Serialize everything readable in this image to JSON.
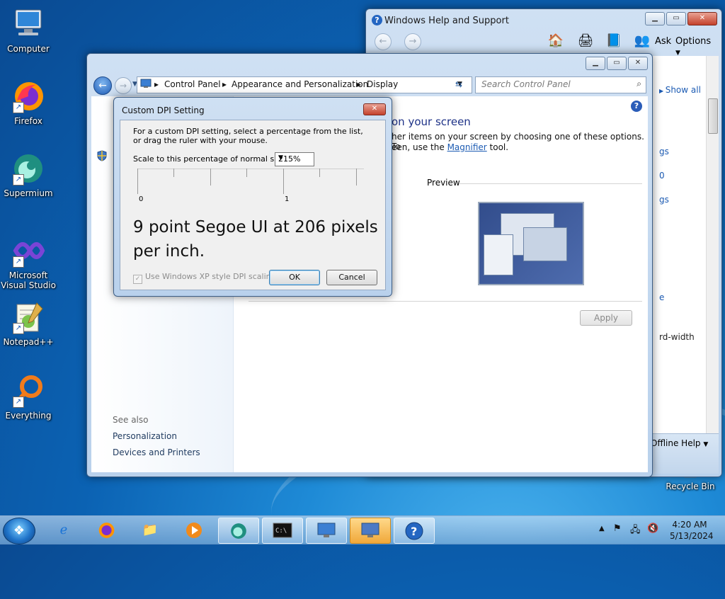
{
  "desktop": {
    "icons": [
      {
        "label": "Computer"
      },
      {
        "label": "Firefox"
      },
      {
        "label": "Supermium"
      },
      {
        "label": "Microsoft Visual Studio"
      },
      {
        "label": "Notepad++"
      },
      {
        "label": "Everything"
      },
      {
        "label": "Recycle Bin"
      }
    ]
  },
  "help_window": {
    "title": "Windows Help and Support",
    "ask_label": "Ask",
    "options_label": "Options",
    "show_all": "Show all",
    "side_fragments": [
      "gs",
      "0",
      "gs",
      "e",
      "rd-width"
    ],
    "offline_help": "Offline Help"
  },
  "control_panel": {
    "breadcrumb": [
      "Control Panel",
      "Appearance and Personalization",
      "Display"
    ],
    "search_placeholder": "Search Control Panel",
    "heading": "on your screen",
    "para_line1": "her items on your screen by choosing one of these options. To",
    "para_line2_pre": "een, use the",
    "magnifier_link": "Magnifier",
    "para_line2_post": "tool.",
    "preview_label": "Preview",
    "apply_label": "Apply",
    "see_also": "See also",
    "links": [
      "Personalization",
      "Devices and Printers"
    ]
  },
  "dpi_dialog": {
    "title": "Custom DPI Setting",
    "description": "For a custom DPI setting, select a percentage from the list, or drag the ruler with your mouse.",
    "scale_label": "Scale to this percentage of normal size:",
    "scale_value": "215%",
    "ruler_labels": [
      "0",
      "1"
    ],
    "sample_text": "9 point Segoe UI at 206 pixels per inch.",
    "xp_checkbox_label": "Use Windows XP style DPI scaling",
    "xp_checkbox_checked": true,
    "ok_label": "OK",
    "cancel_label": "Cancel"
  },
  "taskbar": {
    "clock_time": "4:20 AM",
    "clock_date": "5/13/2024"
  }
}
